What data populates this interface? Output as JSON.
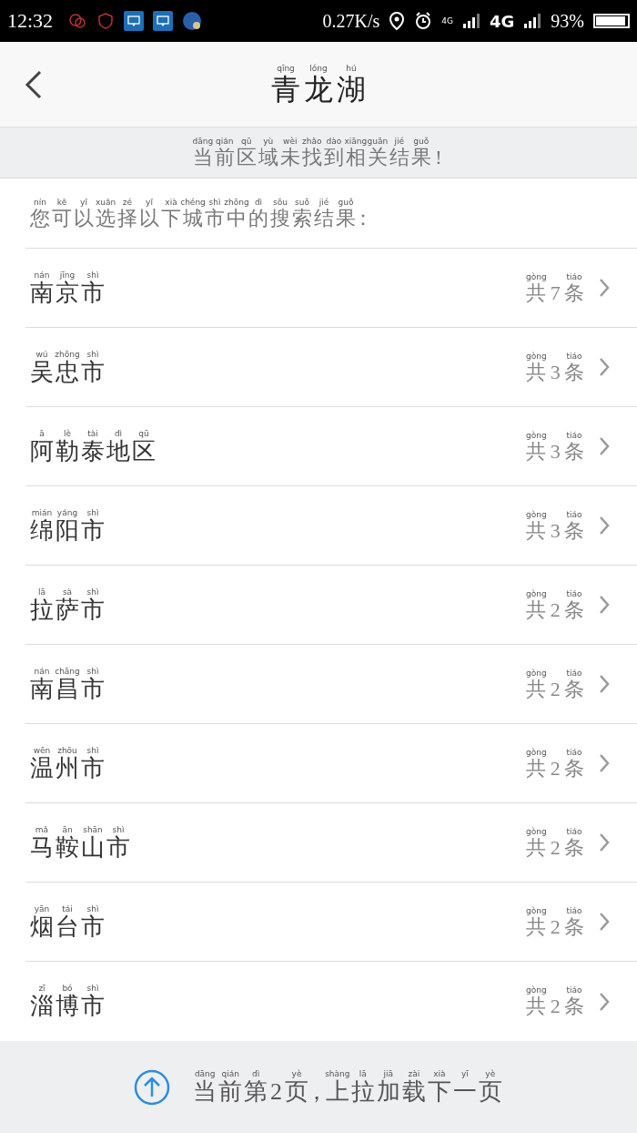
{
  "status_bar": {
    "time": "12:32",
    "speed": "0.27K/s",
    "network_small": "4G",
    "network": "4G",
    "battery": "93%"
  },
  "header": {
    "title": [
      {
        "text": "青",
        "pinyin": "qīng"
      },
      {
        "text": "龙",
        "pinyin": "lóng"
      },
      {
        "text": "湖",
        "pinyin": "hú"
      }
    ]
  },
  "notice": [
    {
      "text": "当",
      "pinyin": "dāng"
    },
    {
      "text": "前",
      "pinyin": "qián"
    },
    {
      "text": "区",
      "pinyin": "qū"
    },
    {
      "text": "域",
      "pinyin": "yù"
    },
    {
      "text": "未",
      "pinyin": "wèi"
    },
    {
      "text": "找",
      "pinyin": "zhǎo"
    },
    {
      "text": "到",
      "pinyin": "dào"
    },
    {
      "text": "相",
      "pinyin": "xiāng"
    },
    {
      "text": "关",
      "pinyin": "guān"
    },
    {
      "text": "结",
      "pinyin": "jié"
    },
    {
      "text": "果",
      "pinyin": "guǒ"
    },
    {
      "text": "!"
    }
  ],
  "prompt": [
    {
      "text": "您",
      "pinyin": "nín"
    },
    {
      "text": "可",
      "pinyin": "kě"
    },
    {
      "text": "以",
      "pinyin": "yǐ"
    },
    {
      "text": "选",
      "pinyin": "xuǎn"
    },
    {
      "text": "择",
      "pinyin": "zé"
    },
    {
      "text": "以",
      "pinyin": "yǐ"
    },
    {
      "text": "下",
      "pinyin": "xià"
    },
    {
      "text": "城",
      "pinyin": "chéng"
    },
    {
      "text": "市",
      "pinyin": "shì"
    },
    {
      "text": "中",
      "pinyin": "zhōng"
    },
    {
      "text": "的",
      "pinyin": "dì"
    },
    {
      "text": "搜",
      "pinyin": "sōu"
    },
    {
      "text": "索",
      "pinyin": "suǒ"
    },
    {
      "text": "结",
      "pinyin": "jié"
    },
    {
      "text": "果",
      "pinyin": "guǒ"
    },
    {
      "text": "："
    }
  ],
  "cities": [
    {
      "name": [
        {
          "text": "南",
          "pinyin": "nán"
        },
        {
          "text": "京",
          "pinyin": "jīng"
        },
        {
          "text": "市",
          "pinyin": "shì"
        }
      ],
      "count": [
        {
          "text": "共",
          "pinyin": "gòng"
        },
        {
          "text": "7"
        },
        {
          "text": "条",
          "pinyin": "tiáo"
        }
      ]
    },
    {
      "name": [
        {
          "text": "吴",
          "pinyin": "wú"
        },
        {
          "text": "忠",
          "pinyin": "zhōng"
        },
        {
          "text": "市",
          "pinyin": "shì"
        }
      ],
      "count": [
        {
          "text": "共",
          "pinyin": "gòng"
        },
        {
          "text": "3"
        },
        {
          "text": "条",
          "pinyin": "tiáo"
        }
      ]
    },
    {
      "name": [
        {
          "text": "阿",
          "pinyin": "ā"
        },
        {
          "text": "勒",
          "pinyin": "lè"
        },
        {
          "text": "泰",
          "pinyin": "tài"
        },
        {
          "text": "地",
          "pinyin": "dì"
        },
        {
          "text": "区",
          "pinyin": "qū"
        }
      ],
      "count": [
        {
          "text": "共",
          "pinyin": "gòng"
        },
        {
          "text": "3"
        },
        {
          "text": "条",
          "pinyin": "tiáo"
        }
      ]
    },
    {
      "name": [
        {
          "text": "绵",
          "pinyin": "mián"
        },
        {
          "text": "阳",
          "pinyin": "yáng"
        },
        {
          "text": "市",
          "pinyin": "shì"
        }
      ],
      "count": [
        {
          "text": "共",
          "pinyin": "gòng"
        },
        {
          "text": "3"
        },
        {
          "text": "条",
          "pinyin": "tiáo"
        }
      ]
    },
    {
      "name": [
        {
          "text": "拉",
          "pinyin": "lā"
        },
        {
          "text": "萨",
          "pinyin": "sà"
        },
        {
          "text": "市",
          "pinyin": "shì"
        }
      ],
      "count": [
        {
          "text": "共",
          "pinyin": "gòng"
        },
        {
          "text": "2"
        },
        {
          "text": "条",
          "pinyin": "tiáo"
        }
      ]
    },
    {
      "name": [
        {
          "text": "南",
          "pinyin": "nán"
        },
        {
          "text": "昌",
          "pinyin": "chāng"
        },
        {
          "text": "市",
          "pinyin": "shì"
        }
      ],
      "count": [
        {
          "text": "共",
          "pinyin": "gòng"
        },
        {
          "text": "2"
        },
        {
          "text": "条",
          "pinyin": "tiáo"
        }
      ]
    },
    {
      "name": [
        {
          "text": "温",
          "pinyin": "wēn"
        },
        {
          "text": "州",
          "pinyin": "zhōu"
        },
        {
          "text": "市",
          "pinyin": "shì"
        }
      ],
      "count": [
        {
          "text": "共",
          "pinyin": "gòng"
        },
        {
          "text": "2"
        },
        {
          "text": "条",
          "pinyin": "tiáo"
        }
      ]
    },
    {
      "name": [
        {
          "text": "马",
          "pinyin": "mǎ"
        },
        {
          "text": "鞍",
          "pinyin": "ān"
        },
        {
          "text": "山",
          "pinyin": "shān"
        },
        {
          "text": "市",
          "pinyin": "shì"
        }
      ],
      "count": [
        {
          "text": "共",
          "pinyin": "gòng"
        },
        {
          "text": "2"
        },
        {
          "text": "条",
          "pinyin": "tiáo"
        }
      ]
    },
    {
      "name": [
        {
          "text": "烟",
          "pinyin": "yān"
        },
        {
          "text": "台",
          "pinyin": "tái"
        },
        {
          "text": "市",
          "pinyin": "shì"
        }
      ],
      "count": [
        {
          "text": "共",
          "pinyin": "gòng"
        },
        {
          "text": "2"
        },
        {
          "text": "条",
          "pinyin": "tiáo"
        }
      ]
    },
    {
      "name": [
        {
          "text": "淄",
          "pinyin": "zī"
        },
        {
          "text": "博",
          "pinyin": "bó"
        },
        {
          "text": "市",
          "pinyin": "shì"
        }
      ],
      "count": [
        {
          "text": "共",
          "pinyin": "gòng"
        },
        {
          "text": "2"
        },
        {
          "text": "条",
          "pinyin": "tiáo"
        }
      ]
    }
  ],
  "footer": [
    {
      "text": "当",
      "pinyin": "dāng"
    },
    {
      "text": "前",
      "pinyin": "qián"
    },
    {
      "text": "第",
      "pinyin": "dì"
    },
    {
      "text": "2"
    },
    {
      "text": "页",
      "pinyin": "yè"
    },
    {
      "text": "，"
    },
    {
      "text": "上",
      "pinyin": "shàng"
    },
    {
      "text": "拉",
      "pinyin": "lā"
    },
    {
      "text": "加",
      "pinyin": "jiā"
    },
    {
      "text": "载",
      "pinyin": "zài"
    },
    {
      "text": "下",
      "pinyin": "xià"
    },
    {
      "text": "一",
      "pinyin": "yī"
    },
    {
      "text": "页",
      "pinyin": "yè"
    }
  ]
}
